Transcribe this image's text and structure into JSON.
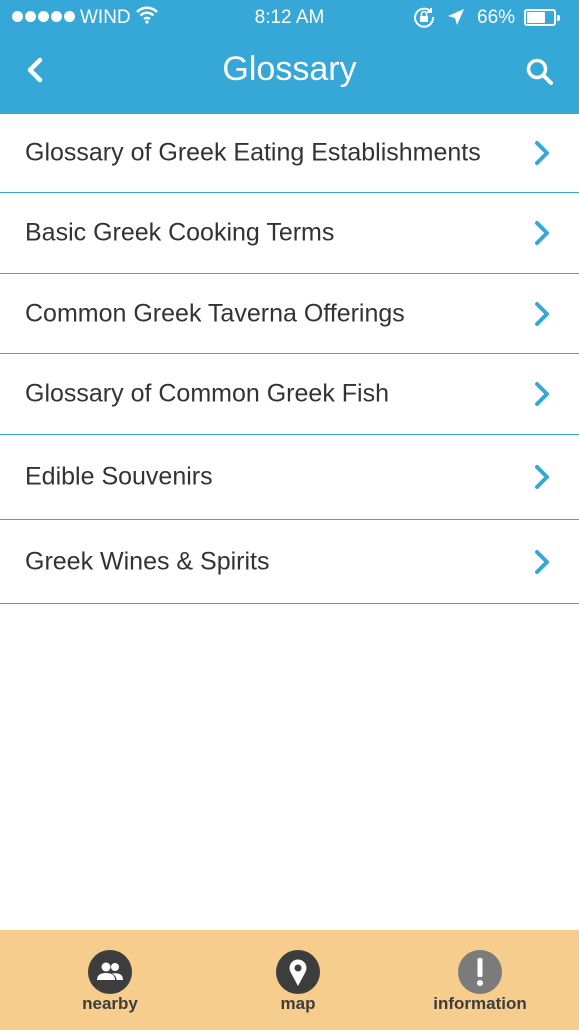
{
  "status_bar": {
    "carrier": "WIND",
    "time": "8:12 AM",
    "battery_percent": "66%",
    "battery_level": 0.66,
    "signal_bars": 5
  },
  "nav": {
    "title": "Glossary",
    "back_icon": "chevron-left-icon",
    "search_icon": "search-icon"
  },
  "list": {
    "items": [
      {
        "label": "Glossary of Greek Eating Establishments"
      },
      {
        "label": "Basic Greek Cooking Terms"
      },
      {
        "label": "Common Greek Taverna Offerings"
      },
      {
        "label": "Glossary of Common Greek Fish"
      },
      {
        "label": "Edible Souvenirs"
      },
      {
        "label": "Greek Wines & Spirits"
      }
    ]
  },
  "tab_bar": {
    "tabs": [
      {
        "label": "nearby",
        "icon": "people-icon"
      },
      {
        "label": "map",
        "icon": "map-pin-icon"
      },
      {
        "label": "information",
        "icon": "info-icon"
      }
    ]
  },
  "colors": {
    "header": "#35a8d8",
    "accent": "#35a8d8",
    "tab_bar": "#f6cd8c",
    "text": "#333333"
  }
}
